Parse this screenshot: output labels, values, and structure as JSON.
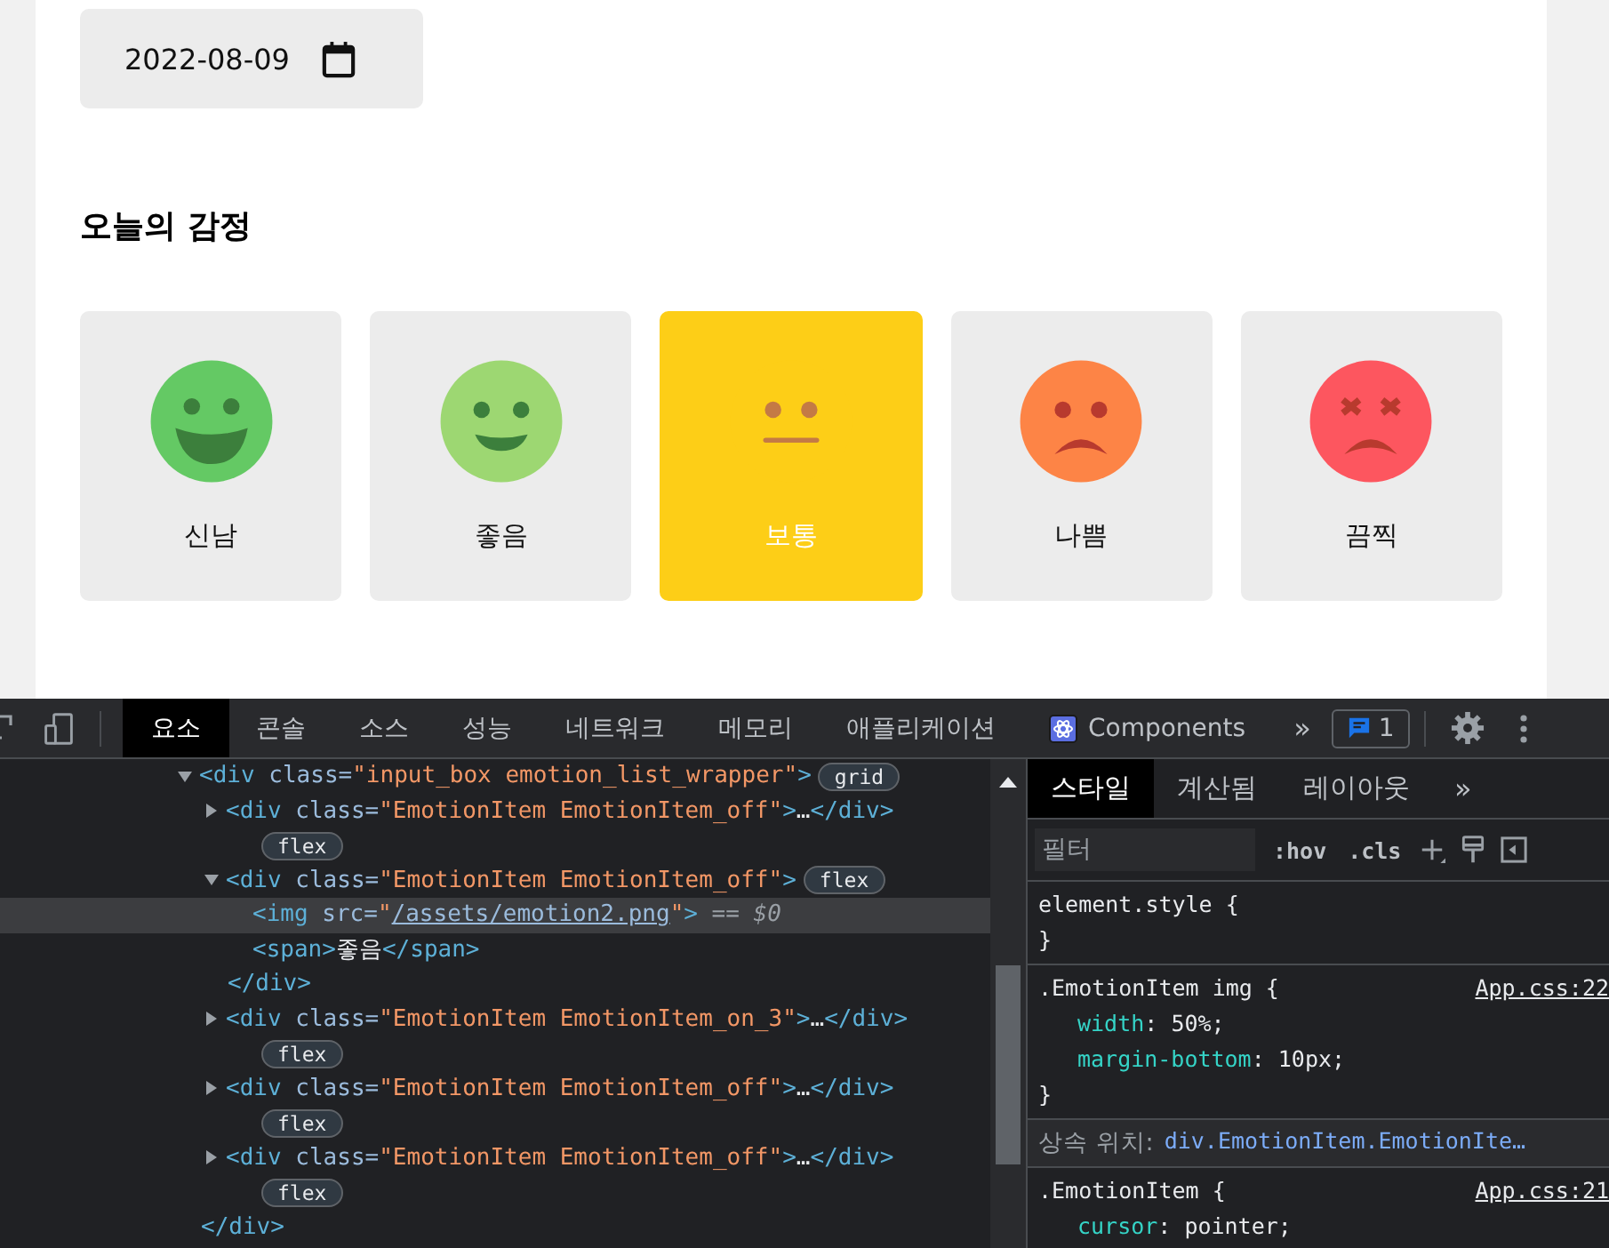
{
  "page": {
    "date": "2022-08-09",
    "section_title": "오늘의 감정",
    "emotions": [
      {
        "kind": "excited",
        "label": "신남",
        "color": "#64c964",
        "selected": false
      },
      {
        "kind": "good",
        "label": "좋음",
        "color": "#9dd772",
        "selected": false
      },
      {
        "kind": "neutral",
        "label": "보통",
        "color": "#fdce17",
        "selected": true
      },
      {
        "kind": "bad",
        "label": "나쁨",
        "color": "#fd8446",
        "selected": false
      },
      {
        "kind": "terrible",
        "label": "끔찍",
        "color": "#fd565f",
        "selected": false
      }
    ]
  },
  "devtools": {
    "tabs": [
      {
        "label": "요소",
        "selected": true
      },
      {
        "label": "콘솔",
        "selected": false
      },
      {
        "label": "소스",
        "selected": false
      },
      {
        "label": "성능",
        "selected": false
      },
      {
        "label": "네트워크",
        "selected": false
      },
      {
        "label": "메모리",
        "selected": false
      },
      {
        "label": "애플리케이션",
        "selected": false
      },
      {
        "label": "Components",
        "selected": false
      }
    ],
    "more": "»",
    "issues_count": "1",
    "tree": [
      {
        "parts": [
          {
            "kind": "tag",
            "text": "<div"
          },
          {
            "kind": "attr",
            "text": " class="
          },
          {
            "kind": "value",
            "text": "\"input_box emotion_list_wrapper\""
          },
          {
            "kind": "tag",
            "text": ">"
          }
        ],
        "badge": "grid",
        "expanded": true,
        "selected": false,
        "close": "</div>",
        "children": [
          {
            "parts": [
              {
                "kind": "tag",
                "text": "<div"
              },
              {
                "kind": "attr",
                "text": " class="
              },
              {
                "kind": "value",
                "text": "\"EmotionItem EmotionItem_off\""
              },
              {
                "kind": "tag",
                "text": ">"
              },
              {
                "kind": "text",
                "text": "…"
              },
              {
                "kind": "tag",
                "text": "</div>"
              }
            ],
            "badge": "flex",
            "expanded": false,
            "selected": false
          },
          {
            "parts": [
              {
                "kind": "tag",
                "text": "<div"
              },
              {
                "kind": "attr",
                "text": " class="
              },
              {
                "kind": "value",
                "text": "\"EmotionItem EmotionItem_off\""
              },
              {
                "kind": "tag",
                "text": ">"
              }
            ],
            "badge": "flex",
            "expanded": true,
            "selected": false,
            "close": "</div>",
            "children": [
              {
                "parts": [
                  {
                    "kind": "tag",
                    "text": "<img"
                  },
                  {
                    "kind": "attr",
                    "text": " src="
                  },
                  {
                    "kind": "value",
                    "text": "\""
                  },
                  {
                    "kind": "link",
                    "text": "/assets/emotion2.png"
                  },
                  {
                    "kind": "value",
                    "text": "\""
                  },
                  {
                    "kind": "tag",
                    "text": ">"
                  },
                  {
                    "kind": "note",
                    "text": " == $0"
                  }
                ],
                "selected": true
              },
              {
                "parts": [
                  {
                    "kind": "tag",
                    "text": "<span>"
                  },
                  {
                    "kind": "text",
                    "text": "좋음"
                  },
                  {
                    "kind": "tag",
                    "text": "</span>"
                  }
                ],
                "selected": false
              }
            ]
          },
          {
            "parts": [
              {
                "kind": "tag",
                "text": "<div"
              },
              {
                "kind": "attr",
                "text": " class="
              },
              {
                "kind": "value",
                "text": "\"EmotionItem EmotionItem_on_3\""
              },
              {
                "kind": "tag",
                "text": ">"
              },
              {
                "kind": "text",
                "text": "…"
              },
              {
                "kind": "tag",
                "text": "</div>"
              }
            ],
            "badge": "flex",
            "expanded": false,
            "selected": false
          },
          {
            "parts": [
              {
                "kind": "tag",
                "text": "<div"
              },
              {
                "kind": "attr",
                "text": " class="
              },
              {
                "kind": "value",
                "text": "\"EmotionItem EmotionItem_off\""
              },
              {
                "kind": "tag",
                "text": ">"
              },
              {
                "kind": "text",
                "text": "…"
              },
              {
                "kind": "tag",
                "text": "</div>"
              }
            ],
            "badge": "flex",
            "expanded": false,
            "selected": false
          },
          {
            "parts": [
              {
                "kind": "tag",
                "text": "<div"
              },
              {
                "kind": "attr",
                "text": " class="
              },
              {
                "kind": "value",
                "text": "\"EmotionItem EmotionItem_off\""
              },
              {
                "kind": "tag",
                "text": ">"
              },
              {
                "kind": "text",
                "text": "…"
              },
              {
                "kind": "tag",
                "text": "</div>"
              }
            ],
            "badge": "flex",
            "expanded": false,
            "selected": false
          }
        ]
      }
    ],
    "side_tabs": [
      {
        "label": "스타일",
        "selected": true
      },
      {
        "label": "계산됨",
        "selected": false
      },
      {
        "label": "레이아웃",
        "selected": false
      }
    ],
    "side_more": "»",
    "filter": {
      "placeholder": "필터"
    },
    "style_buttons": [
      ":hov",
      ".cls"
    ],
    "rules": [
      {
        "kind": "rule",
        "selector": "element.style",
        "open": "{",
        "close": "}"
      },
      {
        "kind": "rule",
        "selector": ".EmotionItem img",
        "open": "{",
        "source": "App.css:22",
        "props": [
          {
            "name": "width",
            "value": ": 50%;"
          },
          {
            "name": "margin-bottom",
            "value": ": 10px;"
          }
        ],
        "close": "}"
      },
      {
        "kind": "inherited",
        "label": "상속 위치:",
        "link": "div.EmotionItem.EmotionIte…"
      },
      {
        "kind": "rule",
        "selector": ".EmotionItem",
        "open": "{",
        "source": "App.css:21",
        "props": [
          {
            "name": "cursor",
            "value": ": pointer;"
          }
        ]
      }
    ]
  }
}
